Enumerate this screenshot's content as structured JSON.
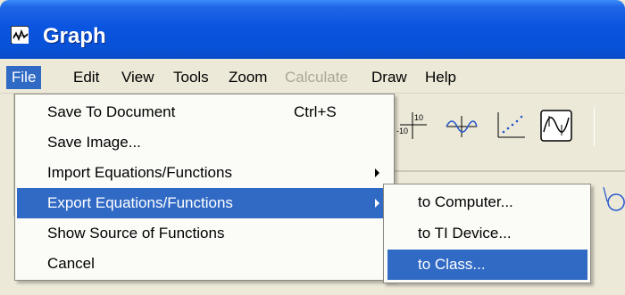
{
  "window": {
    "title": "Graph",
    "icon": "graph-app-icon"
  },
  "menubar": {
    "items": [
      {
        "label": "File",
        "state": "active"
      },
      {
        "label": "Edit",
        "state": "normal"
      },
      {
        "label": "View",
        "state": "normal"
      },
      {
        "label": "Tools",
        "state": "normal"
      },
      {
        "label": "Zoom",
        "state": "normal"
      },
      {
        "label": "Calculate",
        "state": "disabled"
      },
      {
        "label": "Draw",
        "state": "normal"
      },
      {
        "label": "Help",
        "state": "normal"
      }
    ]
  },
  "file_menu": {
    "items": [
      {
        "label": "Save To Document",
        "shortcut": "Ctrl+S"
      },
      {
        "label": "Save Image..."
      },
      {
        "label": "Import Equations/Functions",
        "submenu": true
      },
      {
        "label": "Export Equations/Functions",
        "submenu": true,
        "highlighted": true
      },
      {
        "label": "Show Source of Functions"
      },
      {
        "label": "Cancel"
      }
    ]
  },
  "export_submenu": {
    "items": [
      {
        "label": "to Computer..."
      },
      {
        "label": "to TI Device..."
      },
      {
        "label": "to Class...",
        "highlighted": true
      }
    ]
  },
  "toolbar": {
    "buttons": [
      "window-settings-icon",
      "graph-wave-icon",
      "scatter-plot-icon",
      "trace-icon"
    ],
    "window_labels": {
      "top": "10",
      "left": "-10"
    }
  },
  "colors": {
    "titlebar": "#0a54e0",
    "highlight": "#316ac5",
    "menu_bg": "#ece9d8",
    "disabled": "#aca899"
  }
}
